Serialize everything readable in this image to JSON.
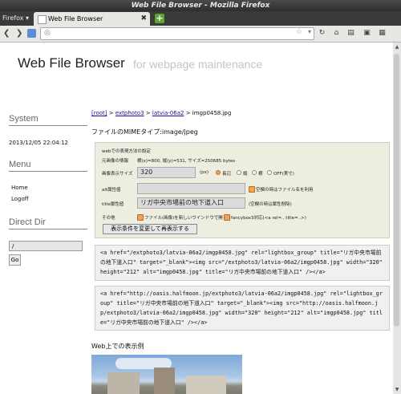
{
  "window": {
    "title": "Web File Browser - Mozilla Firefox"
  },
  "browser": {
    "menu_label": "Firefox",
    "tab_label": "Web File Browser",
    "tab_close": "✖",
    "newtab_label": "+",
    "url": ""
  },
  "page": {
    "site_title": "Web File Browser",
    "site_subtitle": "for webpage maintenance",
    "sidebar": {
      "system_heading": "System",
      "datetime": "2013/12/05 22:04:12",
      "menu_heading": "Menu",
      "home": "Home",
      "logoff": "Logoff",
      "dir_heading": "Direct Dir",
      "dir_value": "/",
      "go_label": "Go"
    },
    "breadcrumb": {
      "root": "[root]",
      "sep": ">",
      "crumb1": "extphoto3",
      "crumb2": "latvia-06a2",
      "current": "imgp0458.jpg"
    },
    "mime": "ファイルのMIMEタイプ:image/jpeg",
    "form": {
      "heading": "webでの表現方法の設定",
      "image_info_label": "元画像の情報",
      "image_info_value": "横(x)=800, 縦(y)=531, サイズ=250685 bytes",
      "size_label": "画像表示サイズ",
      "size_value": "320",
      "px": "(px)",
      "radio_long": "長辺",
      "radio_height": "縦",
      "radio_width": "横",
      "radio_off": "OFF(実寸)",
      "alt_label": "alt属性値",
      "alt_value": "",
      "alt_note": "空欄の時はファイル名を利用",
      "title_label": "title属性値",
      "title_value": "リガ中央市場前の地下道入口",
      "title_note": "(空欄の時は属性削除)",
      "other_label": "その他",
      "newwin_label": "ファイル(画像)を新しいウインドウで開く",
      "fancybox_label": "fancybox3対応(<a rel=.. title=..>)",
      "submit_label": "表示条件を変更して再表示する"
    },
    "code1": "<a href=\"/extphoto3/latvia-06a2/imgp0458.jpg\" rel=\"lightbox_group\" title=\"リガ中央市場前の地下道入口\" target=\"_blank\"><img src=\"/extphoto3/latvia-06a2/imgp0458.jpg\" width=\"320\" height=\"212\" alt=\"imgp0458.jpg\" title=\"リガ中央市場前の地下道入口\" /></a>",
    "code2": "<a href=\"http://oasis.halfmoon.jp/extphoto3/latvia-06a2/imgp0458.jpg\" rel=\"lightbox_group\" title=\"リガ中央市場前の地下道入口\" target=\"_blank\"><img src=\"http://oasis.halfmoon.jp/extphoto3/latvia-06a2/imgp0458.jpg\" width=\"320\" height=\"212\" alt=\"imgp0458.jpg\" title=\"リガ中央市場前の地下道入口\" /></a>",
    "sample_heading": "Web上での表示例"
  },
  "icons": {
    "back": "back-arrow-icon",
    "forward": "forward-arrow-icon",
    "home": "home-icon",
    "bookmark_star": "star-icon"
  }
}
